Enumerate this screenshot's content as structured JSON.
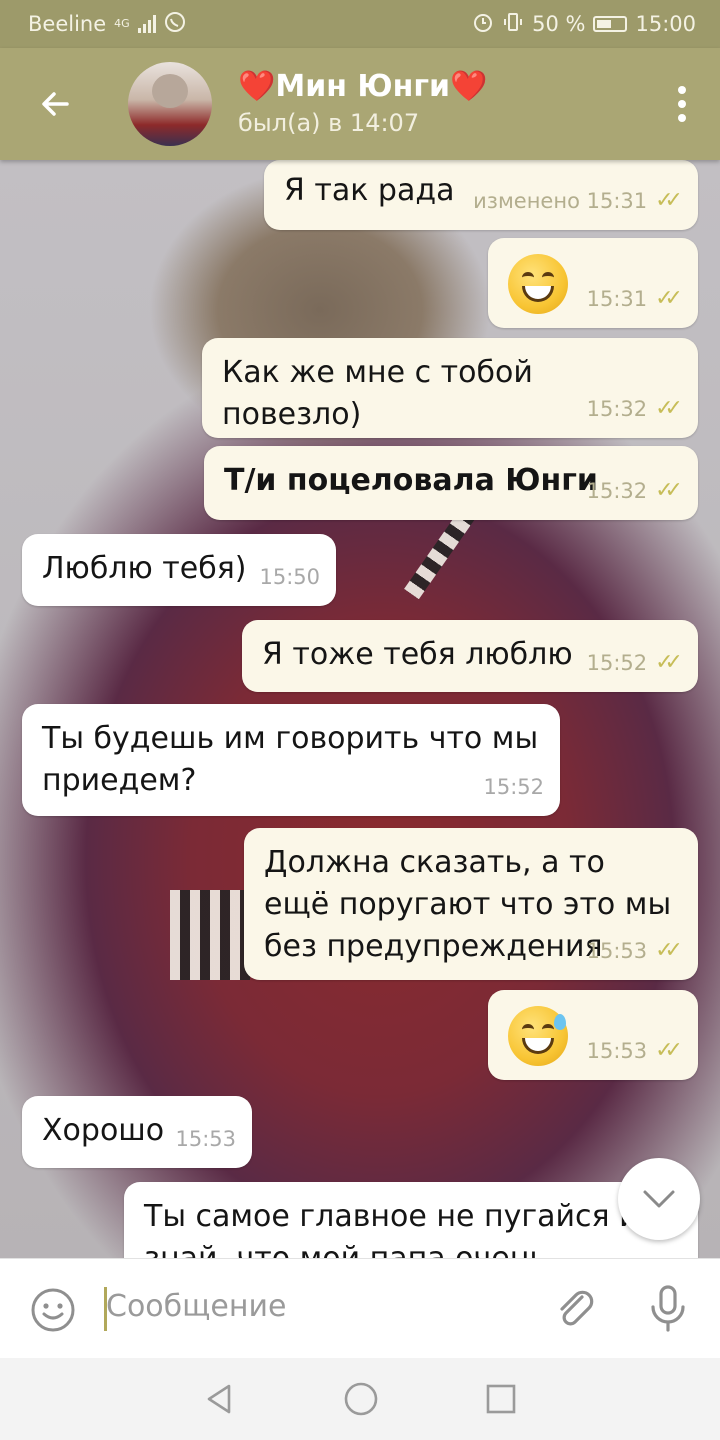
{
  "status_bar": {
    "carrier": "Beeline",
    "network": "4G",
    "battery": "50 %",
    "time": "15:00"
  },
  "header": {
    "contact_name": "❤️Мин Юнги❤️",
    "last_seen": "был(а) в 14:07"
  },
  "messages": [
    {
      "dir": "out",
      "text": "Я так рада",
      "meta": "изменено 15:31"
    },
    {
      "dir": "out",
      "emoji": "grinning",
      "meta": "15:31"
    },
    {
      "dir": "out",
      "text": "Как же мне с тобой повезло)",
      "meta": "15:32"
    },
    {
      "dir": "out",
      "text": "Т/и поцеловала Юнги",
      "meta": "15:32"
    },
    {
      "dir": "in",
      "text": "Люблю тебя)",
      "meta": "15:50"
    },
    {
      "dir": "out",
      "text": "Я тоже тебя люблю",
      "meta": "15:52"
    },
    {
      "dir": "in",
      "text": "Ты будешь им говорить что мы приедем?",
      "meta": "15:52"
    },
    {
      "dir": "out",
      "text": "Должна сказать, а то ещё поругают что это мы без предупреждения",
      "meta": "15:53"
    },
    {
      "dir": "out",
      "emoji": "grinning-sweat",
      "meta": "15:53"
    },
    {
      "dir": "in",
      "text": "Хорошо",
      "meta": "15:53"
    },
    {
      "dir": "in",
      "text": "Ты самое главное не пугайся и знай, что мой папа очень строгий"
    }
  ],
  "input": {
    "placeholder": "Сообщение"
  },
  "icons": {
    "back": "back-arrow-icon",
    "menu": "more-vert-icon",
    "emoji": "smile-icon",
    "attach": "paperclip-icon",
    "mic": "microphone-icon",
    "scroll": "chevron-down-icon",
    "nav": [
      "back-triangle-icon",
      "home-circle-icon",
      "recents-square-icon"
    ]
  },
  "colors": {
    "header": "#aaa674",
    "status_bar": "#9d9a6a",
    "outgoing_bubble": "#fbf7e8",
    "incoming_bubble": "#ffffff",
    "read_check": "#c7bd58"
  }
}
